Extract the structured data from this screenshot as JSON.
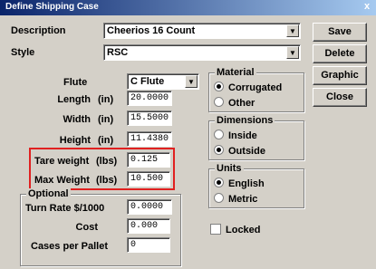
{
  "window": {
    "title": "Define Shipping Case",
    "close_glyph": "x"
  },
  "description": {
    "label": "Description",
    "value": "Cheerios 16 Count"
  },
  "style": {
    "label": "Style",
    "value": "RSC"
  },
  "buttons": {
    "save": "Save",
    "delete": "Delete",
    "graphic": "Graphic",
    "close": "Close"
  },
  "flute": {
    "label": "Flute",
    "value": "C Flute"
  },
  "length": {
    "label": "Length",
    "unit": "(in)",
    "value": "20.0000"
  },
  "width": {
    "label": "Width",
    "unit": "(in)",
    "value": "15.5000"
  },
  "height": {
    "label": "Height",
    "unit": "(in)",
    "value": "11.4380"
  },
  "tare_weight": {
    "label": "Tare weight",
    "unit": "(lbs)",
    "value": "0.125"
  },
  "max_weight": {
    "label": "Max Weight",
    "unit": "(lbs)",
    "value": "10.500"
  },
  "optional": {
    "legend": "Optional",
    "turn_rate": {
      "label": "Turn Rate $/1000",
      "value": "0.0000"
    },
    "cost": {
      "label": "Cost",
      "value": "0.000"
    },
    "cases_per_pallet": {
      "label": "Cases per Pallet",
      "value": "0"
    }
  },
  "material": {
    "legend": "Material",
    "options": [
      "Corrugated",
      "Other"
    ],
    "selected": "Corrugated"
  },
  "dimensions": {
    "legend": "Dimensions",
    "options": [
      "Inside",
      "Outside"
    ],
    "selected": "Outside"
  },
  "units": {
    "legend": "Units",
    "options": [
      "English",
      "Metric"
    ],
    "selected": "English"
  },
  "locked": {
    "label": "Locked",
    "checked": false
  },
  "colors": {
    "title_start": "#0a246a",
    "title_end": "#a6caf0",
    "highlight": "#e02020",
    "face": "#d4d0c8"
  }
}
